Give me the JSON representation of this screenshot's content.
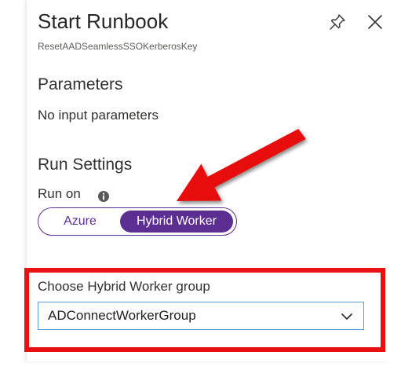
{
  "blade": {
    "title": "Start Runbook",
    "subtitle": "ResetAADSeamlessSSOKerberosKey"
  },
  "header_icons": {
    "pin": "pin-icon",
    "close": "close-icon"
  },
  "parameters": {
    "heading": "Parameters",
    "text": "No input parameters"
  },
  "run_settings": {
    "heading": "Run Settings",
    "run_on_label": "Run on",
    "info_icon": "info-icon",
    "options": [
      {
        "label": "Azure",
        "selected": false
      },
      {
        "label": "Hybrid Worker",
        "selected": true
      }
    ]
  },
  "hybrid_worker_group": {
    "label": "Choose Hybrid Worker group",
    "selected_value": "ADConnectWorkerGroup"
  },
  "colors": {
    "accent": "#5c2e91",
    "annotation_red": "#e81010",
    "dropdown_border": "#5b9bd5"
  }
}
